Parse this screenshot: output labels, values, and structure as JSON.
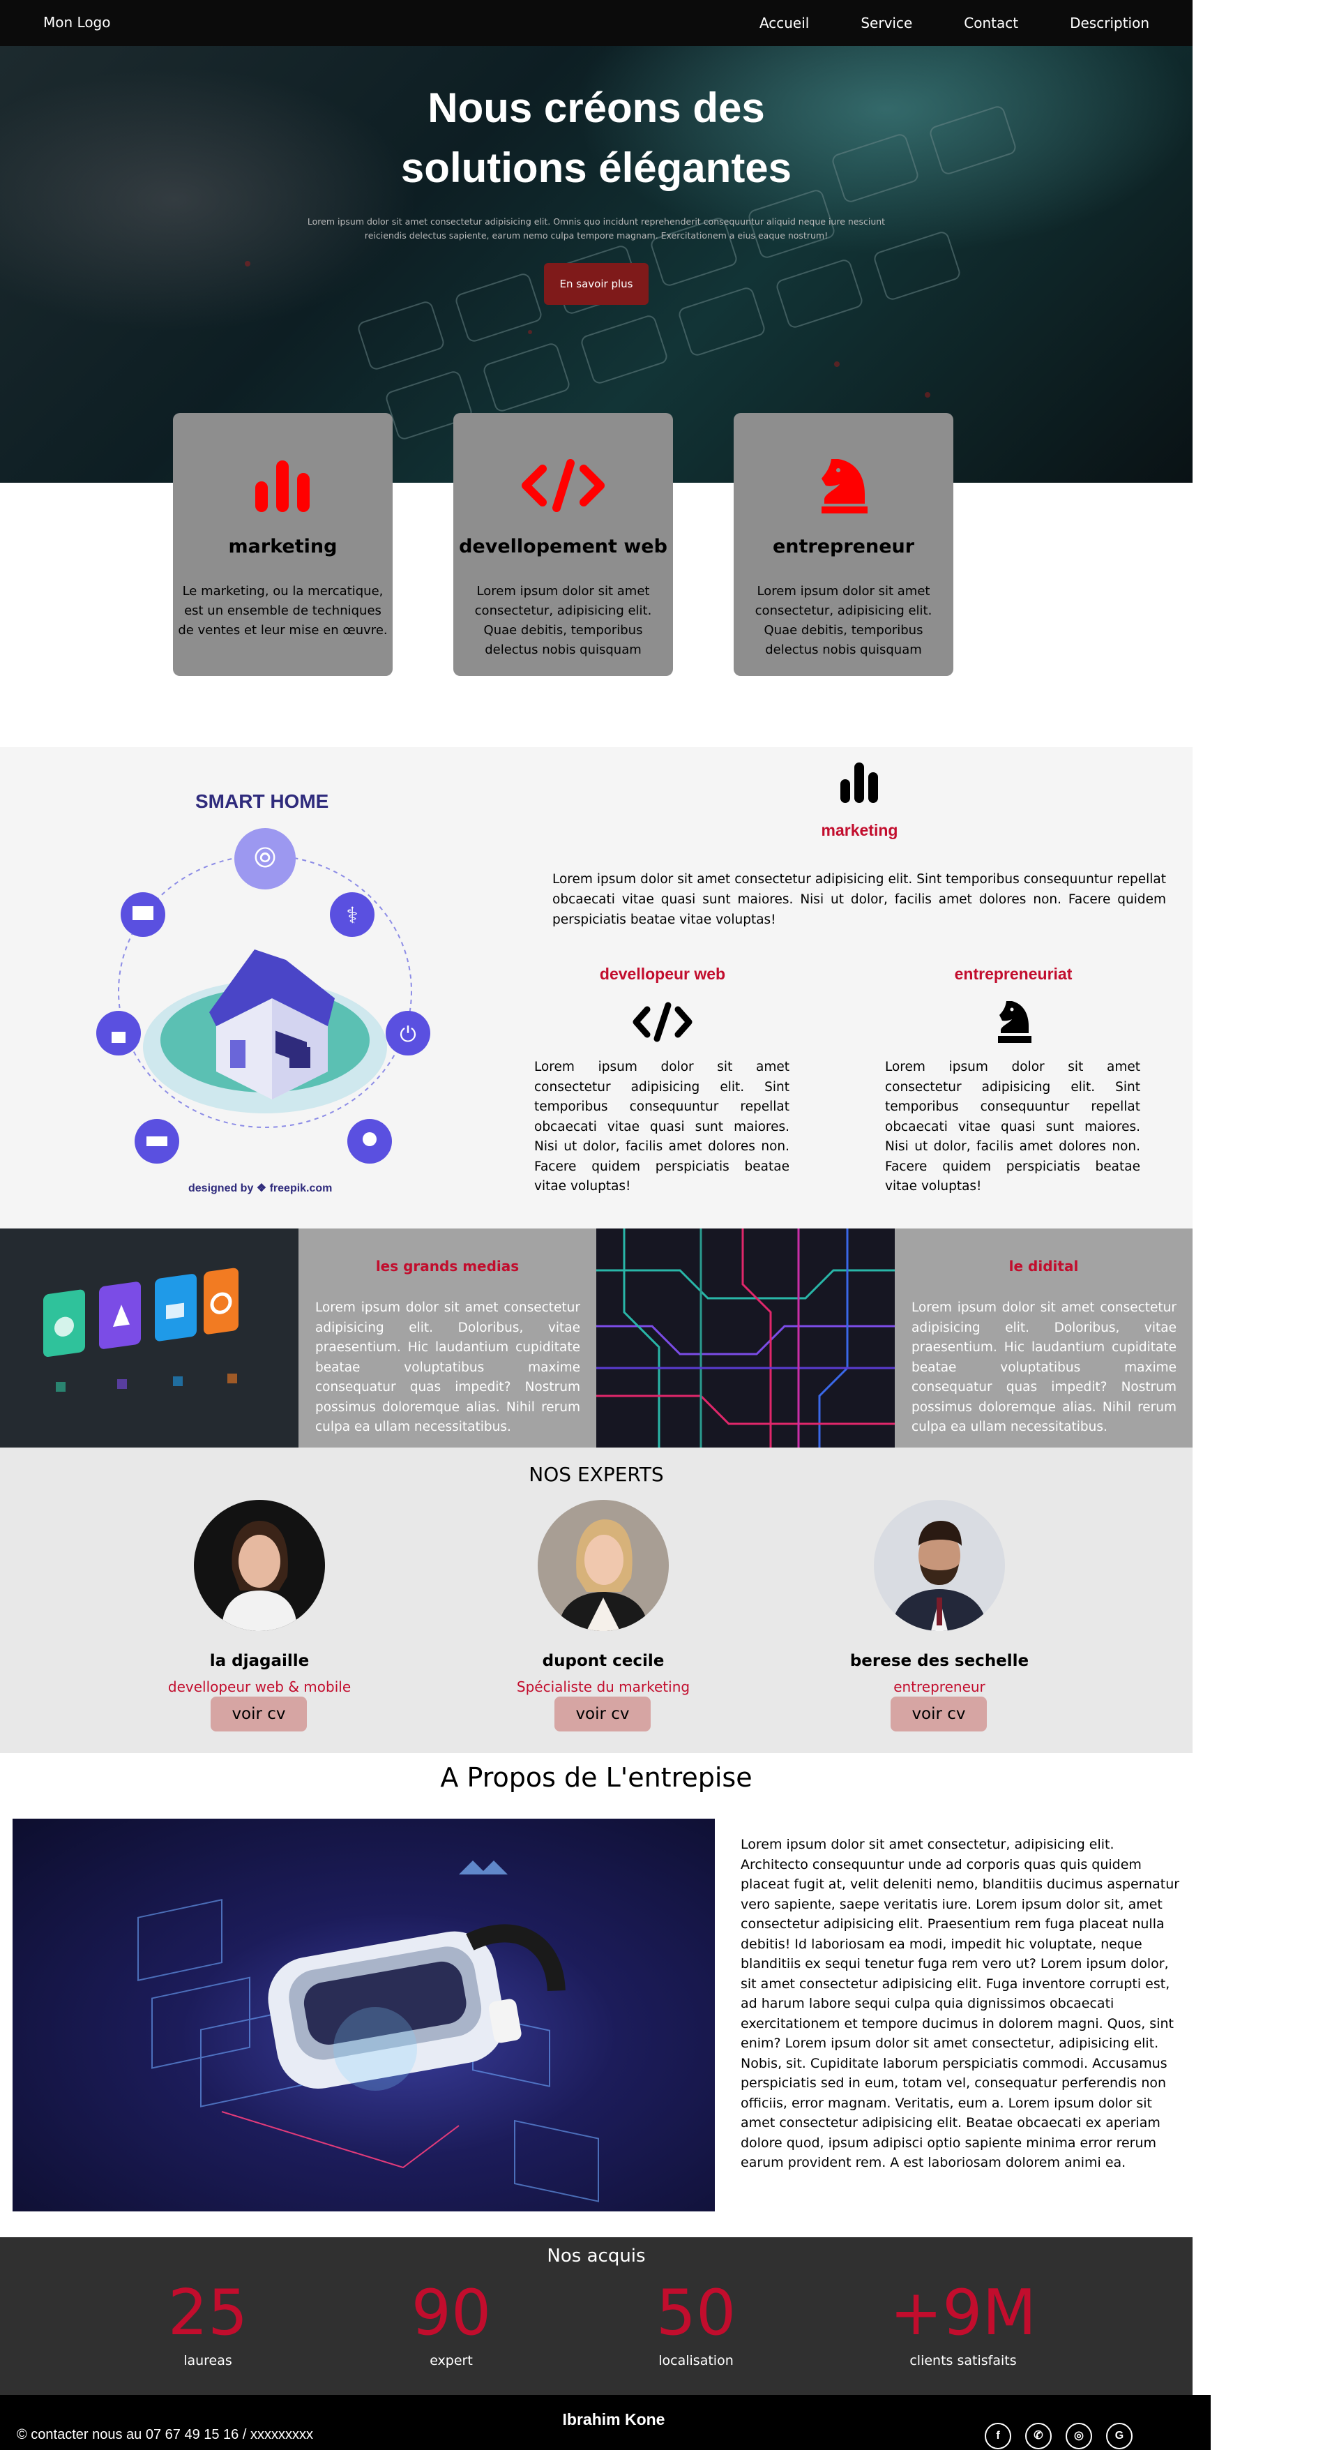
{
  "nav": {
    "logo": "Mon Logo",
    "links": [
      "Accueil",
      "Service",
      "Contact",
      "Description"
    ]
  },
  "hero": {
    "title_line1": "Nous créons des",
    "title_line2": "solutions élégantes",
    "subtitle_line1": "Lorem ipsum dolor sit amet consectetur adipisicing elit. Omnis quo incidunt reprehenderit consequuntur aliquid neque iure nesciunt",
    "subtitle_line2": "reiciendis delectus sapiente, earum nemo culpa tempore magnam. Exercitationem a eius eaque nostrum!",
    "button": "En savoir plus",
    "accent": "#7f1a1a"
  },
  "cards": [
    {
      "icon": "bar-chart-icon",
      "title": "marketing",
      "text": "Le marketing, ou la mercatique, est un ensemble de techniques de ventes et leur mise en œuvre."
    },
    {
      "icon": "code-icon",
      "title": "devellopement web",
      "text": "Lorem ipsum dolor sit amet consectetur, adipisicing elit. Quae debitis, temporibus delectus nobis quisquam"
    },
    {
      "icon": "chess-knight-icon",
      "title": "entrepreneur",
      "text": "Lorem ipsum dolor sit amet consectetur, adipisicing elit. Quae debitis, temporibus delectus nobis quisquam"
    }
  ],
  "smart_home": {
    "title": "SMART HOME",
    "credit": "designed by ❖ freepik.com"
  },
  "features": {
    "marketing": {
      "icon": "bar-chart-icon",
      "title": "marketing",
      "text": "Lorem ipsum dolor sit amet consectetur adipisicing elit. Sint temporibus consequuntur repellat obcaecati vitae quasi sunt maiores. Nisi ut dolor, facilis amet dolores non. Facere quidem perspiciatis beatae vitae voluptas!"
    },
    "dev": {
      "icon": "code-icon",
      "title": "devellopeur web",
      "text": "Lorem ipsum dolor sit amet consectetur adipisicing elit. Sint temporibus consequuntur repellat obcaecati vitae quasi sunt maiores. Nisi ut dolor, facilis amet dolores non. Facere quidem perspiciatis beatae vitae voluptas!"
    },
    "entre": {
      "icon": "chess-knight-icon",
      "title": "entrepreneuriat",
      "text": "Lorem ipsum dolor sit amet consectetur adipisicing elit. Sint temporibus consequuntur repellat obcaecati vitae quasi sunt maiores. Nisi ut dolor, facilis amet dolores non. Facere quidem perspiciatis beatae vitae voluptas!"
    },
    "accent": "#c20d2d"
  },
  "media": [
    {
      "title": "les grands medias",
      "text": "Lorem ipsum dolor sit amet consectetur adipisicing elit. Doloribus, vitae praesentium. Hic laudantium cupiditate beatae voluptatibus maxime consequatur quas impedit? Nostrum possimus doloremque alias. Nihil rerum culpa ea ullam necessitatibus."
    },
    {
      "title": "le didital",
      "text": "Lorem ipsum dolor sit amet consectetur adipisicing elit. Doloribus, vitae praesentium. Hic laudantium cupiditate beatae voluptatibus maxime consequatur quas impedit? Nostrum possimus doloremque alias. Nihil rerum culpa ea ullam necessitatibus."
    }
  ],
  "experts": {
    "title": "NOS EXPERTS",
    "people": [
      {
        "name": "la djagaille",
        "role": "devellopeur web & mobile",
        "cv": "voir cv"
      },
      {
        "name": "dupont cecile",
        "role": "Spécialiste du marketing",
        "cv": "voir cv"
      },
      {
        "name": "berese des sechelle",
        "role": "entrepreneur",
        "cv": "voir cv"
      }
    ]
  },
  "about": {
    "title": "A Propos de L'entrepise",
    "text": "Lorem ipsum dolor sit amet consectetur, adipisicing elit. Architecto consequuntur unde ad corporis quas quis quidem placeat fugit at, velit deleniti nemo, blanditiis ducimus aspernatur vero sapiente, saepe veritatis iure. Lorem ipsum dolor sit, amet consectetur adipisicing elit. Praesentium rem fuga placeat nulla debitis! Id laboriosam ea modi, impedit hic voluptate, neque blanditiis ex sequi tenetur fuga rem vero ut? Lorem ipsum dolor, sit amet consectetur adipisicing elit. Fuga inventore corrupti est, ad harum labore sequi culpa quia dignissimos obcaecati exercitationem et tempore ducimus in dolorem magni. Quos, sint enim? Lorem ipsum dolor sit amet consectetur, adipisicing elit. Nobis, sit. Cupiditate laborum perspiciatis commodi. Accusamus perspiciatis sed in eum, totam vel, consequatur perferendis non officiis, error magnam. Veritatis, eum a. Lorem ipsum dolor sit amet consectetur adipisicing elit. Beatae obcaecati ex aperiam dolore quod, ipsum adipisci optio sapiente minima error rerum earum provident rem. A est laboriosam dolorem animi ea."
  },
  "stats": {
    "title": "Nos acquis",
    "items": [
      {
        "num": "25",
        "label": "laureas"
      },
      {
        "num": "90",
        "label": "expert"
      },
      {
        "num": "50",
        "label": "localisation"
      },
      {
        "num": "+9M",
        "label": "clients satisfaits"
      }
    ]
  },
  "footer": {
    "name": "Ibrahim Kone",
    "contact": "© contacter nous au 07 67 49 15 16 / xxxxxxxxx",
    "socials": [
      {
        "icon": "facebook-icon",
        "glyph": "f"
      },
      {
        "icon": "whatsapp-icon",
        "glyph": "✆"
      },
      {
        "icon": "instagram-icon",
        "glyph": "◎"
      },
      {
        "icon": "google-icon",
        "glyph": "G"
      }
    ]
  }
}
